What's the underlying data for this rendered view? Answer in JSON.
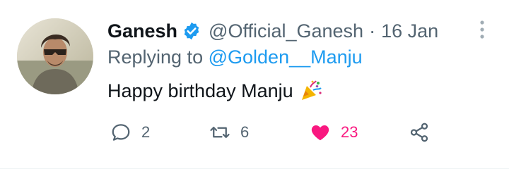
{
  "tweet": {
    "author_name": "Ganesh",
    "author_handle": "@Official_Ganesh",
    "separator": "·",
    "date": "16 Jan",
    "reply_prefix": "Replying to",
    "reply_handle": "@Golden__Manju",
    "text": "Happy birthday Manju",
    "emoji": "party-popper",
    "verified_icon": "verified-badge-icon",
    "colors": {
      "verified": "#1d9bf0",
      "link": "#1d9bf0",
      "like": "#f91880",
      "muted": "#536471"
    }
  },
  "actions": {
    "reply": {
      "icon": "reply-icon",
      "count": "2"
    },
    "retweet": {
      "icon": "retweet-icon",
      "count": "6"
    },
    "like": {
      "icon": "heart-icon",
      "count": "23",
      "liked": true
    },
    "share": {
      "icon": "share-icon",
      "count": ""
    }
  }
}
